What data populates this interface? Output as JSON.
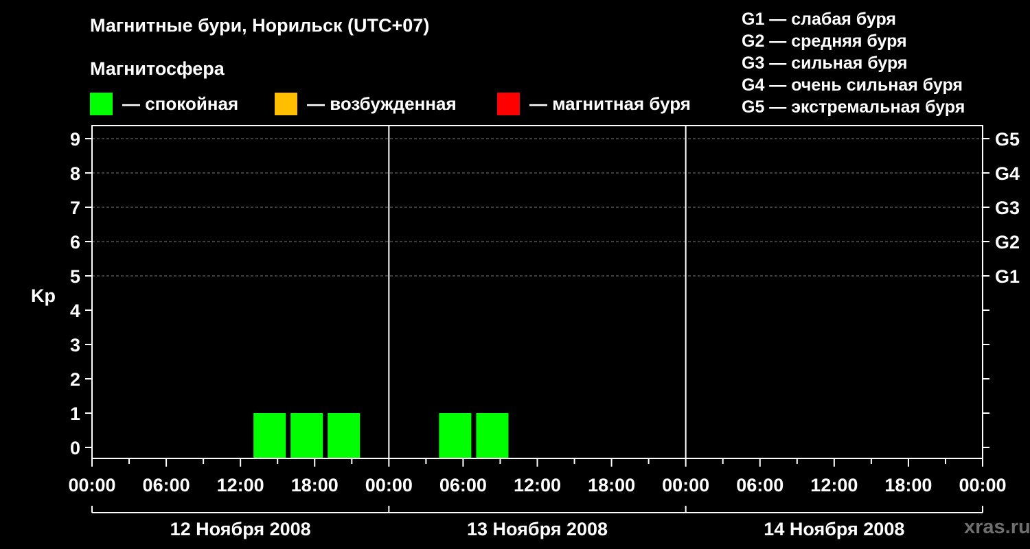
{
  "title": "Магнитные бури, Норильск (UTC+07)",
  "subtitle": "Магнитосфера",
  "legend": [
    {
      "color": "#00ff00",
      "label": "— спокойная"
    },
    {
      "color": "#ffbf00",
      "label": "— возбужденная"
    },
    {
      "color": "#ff0000",
      "label": "— магнитная буря"
    }
  ],
  "storm_scale": [
    "G1 — слабая буря",
    "G2 — средняя буря",
    "G3 — сильная буря",
    "G4 — очень сильная буря",
    "G5 — экстремальная буря"
  ],
  "watermark": "xras.ru",
  "chart_data": {
    "type": "bar",
    "ylabel": "Kp",
    "ylim": [
      0,
      9
    ],
    "y_ticks": [
      "0",
      "1",
      "2",
      "3",
      "4",
      "5",
      "6",
      "7",
      "8",
      "9"
    ],
    "g_levels": [
      {
        "label": "G1",
        "kp": 5
      },
      {
        "label": "G2",
        "kp": 6
      },
      {
        "label": "G3",
        "kp": 7
      },
      {
        "label": "G4",
        "kp": 8
      },
      {
        "label": "G5",
        "kp": 9
      }
    ],
    "x_tick_labels": [
      "00:00",
      "06:00",
      "12:00",
      "18:00",
      "00:00",
      "06:00",
      "12:00",
      "18:00",
      "00:00",
      "06:00",
      "12:00",
      "18:00",
      "00:00"
    ],
    "days": [
      "12 Ноября 2008",
      "13 Ноября 2008",
      "14 Ноября 2008"
    ],
    "bars": [
      {
        "day": 0,
        "start": "13:00",
        "end": "16:00",
        "kp": 1,
        "color": "#00ff00"
      },
      {
        "day": 0,
        "start": "16:00",
        "end": "19:00",
        "kp": 1,
        "color": "#00ff00"
      },
      {
        "day": 0,
        "start": "19:00",
        "end": "22:00",
        "kp": 1,
        "color": "#00ff00"
      },
      {
        "day": 1,
        "start": "04:00",
        "end": "07:00",
        "kp": 1,
        "color": "#00ff00"
      },
      {
        "day": 1,
        "start": "07:00",
        "end": "10:00",
        "kp": 1,
        "color": "#00ff00"
      }
    ]
  }
}
